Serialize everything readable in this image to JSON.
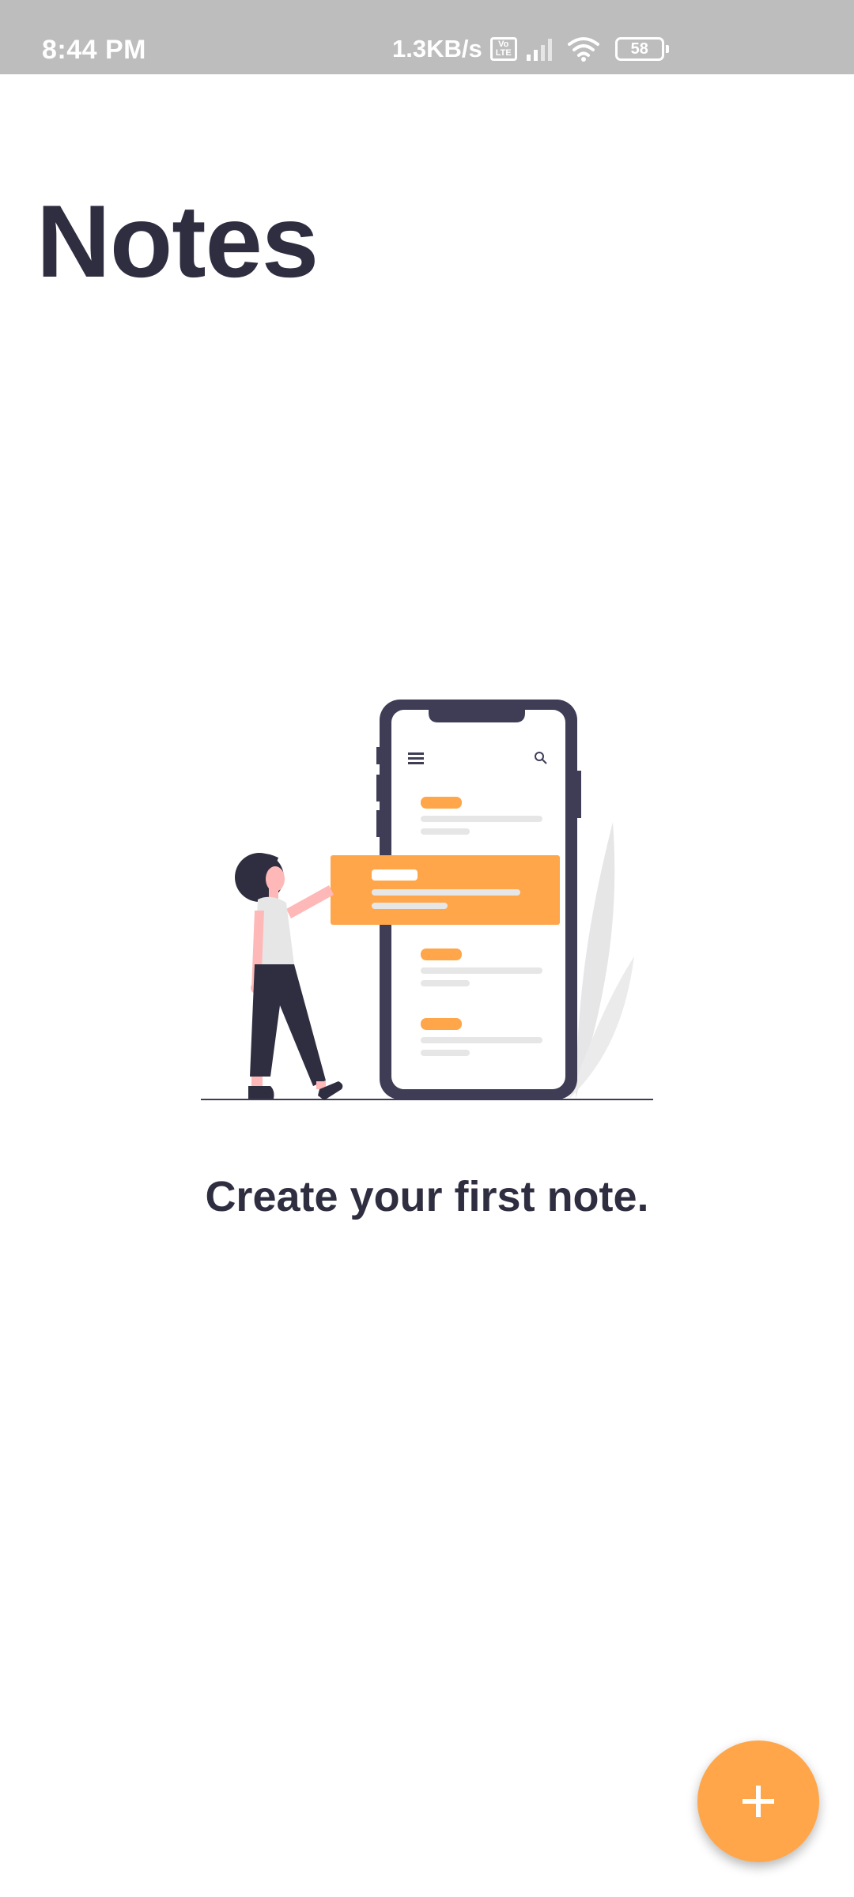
{
  "status_bar": {
    "time": "8:44 PM",
    "net_speed": "1.3KB/s",
    "volte_label": "Vo LTE",
    "battery_level": "58",
    "icons": [
      "volte-icon",
      "signal-icon",
      "wifi-icon",
      "battery-icon"
    ]
  },
  "header": {
    "title": "Notes"
  },
  "empty_state": {
    "illustration": "person-with-phone-notes-illustration",
    "message": "Create your first note."
  },
  "fab": {
    "icon": "plus-icon"
  },
  "colors": {
    "accent": "#ffa64a",
    "text_dark": "#2f2e41",
    "status_bar_bg": "#bdbdbd"
  }
}
